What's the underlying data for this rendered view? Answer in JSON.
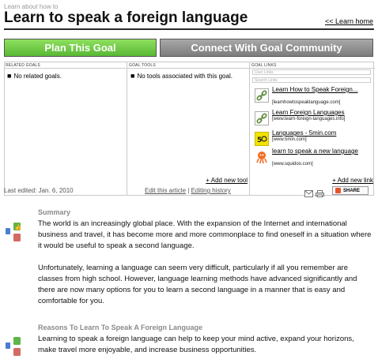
{
  "header": {
    "kicker": "Learn about how to",
    "title": "Learn to speak a foreign language",
    "learn_home": "<< Learn home"
  },
  "buttons": {
    "plan": "Plan This Goal",
    "connect": "Connect With Goal Community"
  },
  "panel": {
    "related": {
      "heading": "RELATED GOALS",
      "text": "No related goals."
    },
    "tools": {
      "heading": "GOAL TOOLS",
      "text": "No tools associated with this goal.",
      "add": "+ Add new tool"
    },
    "links": {
      "heading": "GOAL LINKS",
      "user_links_placeholder": "User Links",
      "search_links_placeholder": "Search Links",
      "add": "+ Add new link",
      "items": [
        {
          "title": "Learn How to Speak Foreign...",
          "url": "[learnhowtospeaklanguage.com]",
          "icon": "link-icon"
        },
        {
          "title": "Learn Foreign Languages",
          "url": "[www.learn-foreign-languages.info]",
          "icon": "link-icon"
        },
        {
          "title": "Languages - 5min.com",
          "url": "[www.5min.com]",
          "icon": "5min-logo-icon"
        },
        {
          "title": "learn to speak a new language",
          "url": "[www.squidoo.com]",
          "icon": "squidoo-logo-icon"
        }
      ]
    }
  },
  "footer": {
    "last_edited": "Last edited: Jan. 6, 2010",
    "edit_article": "Edit this article",
    "separator": " | ",
    "editing_history": "Editing history",
    "share": "SHARE"
  },
  "sections": [
    {
      "title": "Summary",
      "paragraphs": [
        "The world is an increasingly global place.  With the expansion of the Internet and international business and travel, it has become more and more commonplace to find oneself in a situation where it would be useful to speak a second language.",
        "Unfortunately, learning a language can seem very difficult, particularly if all you remember are classes from high school. However, language learning methods have advanced significantly and there are now many options for you to learn a second language in a manner that is easy and comfortable for you."
      ]
    },
    {
      "title": "Reasons To Learn To Speak A Foreign Language",
      "paragraphs": [
        "Learning to speak a foreign language can help to keep your mind active, expand your horizons, make travel more enjoyable, and increase business opportunities."
      ]
    }
  ],
  "colors": {
    "plan_button": "#58b834",
    "connect_button": "#7d7d7d",
    "section_title": "#8a8a8a"
  }
}
